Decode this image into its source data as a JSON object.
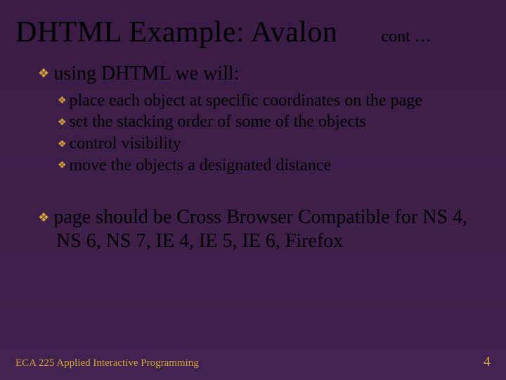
{
  "header": {
    "title": "DHTML Example: Avalon",
    "cont": "cont …"
  },
  "body": {
    "p1": {
      "lead": "using",
      "rest": " DHTML we will:"
    },
    "sub": [
      {
        "lead": "place",
        "rest": " each object at specific coordinates on the page"
      },
      {
        "lead": "set",
        "rest": " the stacking order of some of the objects"
      },
      {
        "lead": "control",
        "rest": " visibility"
      },
      {
        "lead": "move",
        "rest": " the objects a designated distance"
      }
    ],
    "p2": {
      "lead": "page",
      "rest": " should be Cross Browser Compatible for NS 4, NS 6, NS 7, IE 4, IE 5, IE 6, Firefox"
    }
  },
  "footer": {
    "course": "ECA 225   Applied Interactive Programming",
    "page": "4"
  },
  "colors": {
    "bullet": "#d4a537",
    "footer": "#d4a537",
    "bg": "#3e1f4a"
  }
}
